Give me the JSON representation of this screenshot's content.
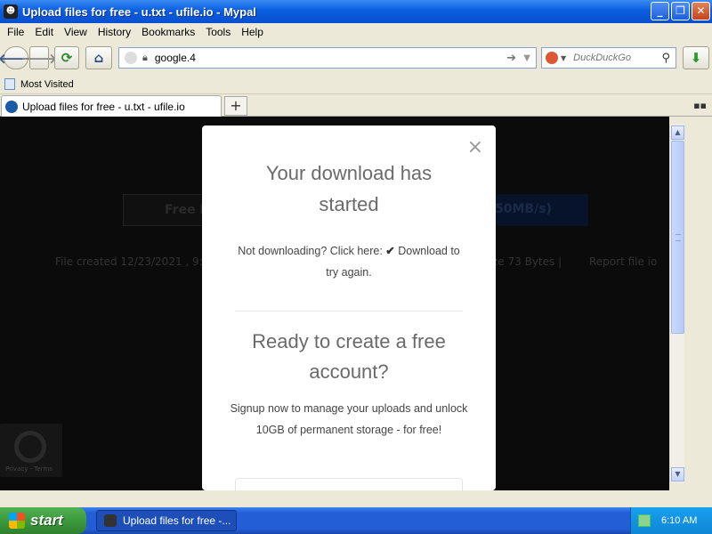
{
  "window": {
    "title": "Upload files for free - u.txt - ufile.io - Mypal",
    "controls": {
      "minimize": "_",
      "maximize": "❐",
      "close": "✕"
    }
  },
  "menu": [
    "File",
    "Edit",
    "View",
    "History",
    "Bookmarks",
    "Tools",
    "Help"
  ],
  "navbar": {
    "back_icon": "🡐",
    "forward_icon": "🡒",
    "reload_icon": "⟳",
    "home_icon": "⌂",
    "url": "google.4",
    "search_placeholder": "DuckDuckGo",
    "download_icon": "⬇"
  },
  "bookmarks": {
    "most_visited": "Most Visited"
  },
  "tabs": [
    {
      "label": "Upload files for free - u.txt - ufile.io"
    }
  ],
  "newtab_label": "+",
  "page": {
    "bg_button_left": "Free D",
    "bg_button_right": "50MB/s)",
    "bg_fileinfo_left": "File created  12/23/2021 , 9:0",
    "bg_fileinfo_right": "ze  73 Bytes    |",
    "bg_report": "Report file io"
  },
  "modal": {
    "close": "×",
    "heading1": "Your download has started",
    "p1_before": "Not downloading? Click here: ",
    "p1_link": "Download",
    "p1_after": " to try again.",
    "heading2": "Ready to create a free account?",
    "p2": "Signup now to manage your uploads and unlock 10GB of permanent storage - for free!"
  },
  "recaptcha": {
    "text": "Privacy - Terms"
  },
  "taskbar": {
    "start_label": "start",
    "task_label": "Upload files for free -...",
    "clock": "6:10 AM"
  },
  "colors": {
    "modal_bg": "#ffffff",
    "page_bg": "#0b0b0b",
    "titlebar": "#0b5ee0",
    "taskbar": "#245ed6",
    "start": "#3c9a3c"
  }
}
